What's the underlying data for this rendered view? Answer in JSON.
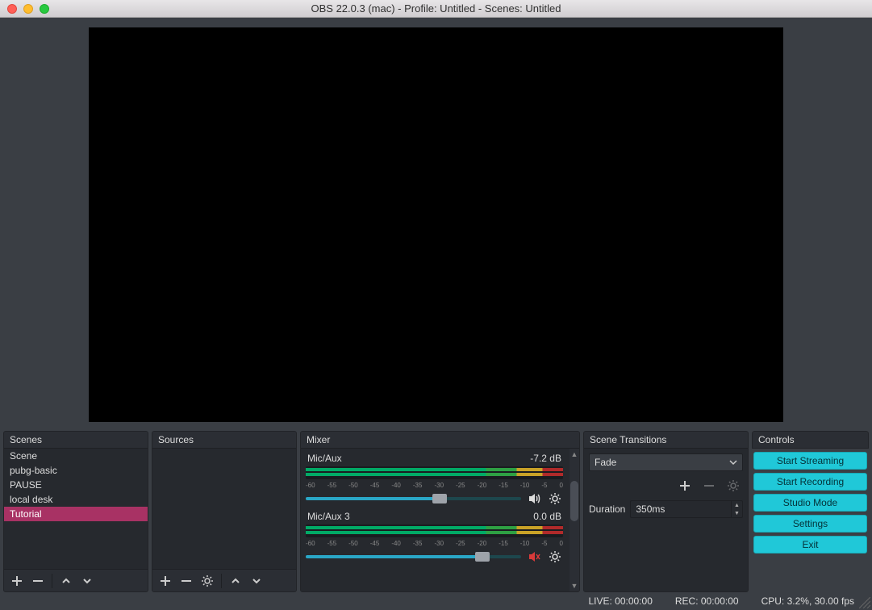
{
  "window": {
    "title": "OBS 22.0.3 (mac) - Profile: Untitled - Scenes: Untitled"
  },
  "panels": {
    "scenes_label": "Scenes",
    "sources_label": "Sources",
    "mixer_label": "Mixer",
    "transitions_label": "Scene Transitions",
    "controls_label": "Controls"
  },
  "scenes": {
    "items": [
      "Scene",
      "pubg-basic",
      "PAUSE",
      "local desk",
      "Tutorial"
    ],
    "selected_index": 4
  },
  "sources": {
    "items": []
  },
  "mixer": {
    "channels": [
      {
        "name": "Mic/Aux",
        "level": "-7.2 dB",
        "muted": false,
        "slider_pct": 62
      },
      {
        "name": "Mic/Aux 3",
        "level": "0.0 dB",
        "muted": true,
        "slider_pct": 82
      }
    ],
    "ticks": [
      "-60",
      "-55",
      "-50",
      "-45",
      "-40",
      "-35",
      "-30",
      "-25",
      "-20",
      "-15",
      "-10",
      "-5",
      "0"
    ]
  },
  "transitions": {
    "current": "Fade",
    "duration_label": "Duration",
    "duration_value": "350ms"
  },
  "controls": {
    "buttons": [
      "Start Streaming",
      "Start Recording",
      "Studio Mode",
      "Settings",
      "Exit"
    ]
  },
  "statusbar": {
    "live": "LIVE: 00:00:00",
    "rec": "REC: 00:00:00",
    "cpu": "CPU: 3.2%, 30.00 fps"
  }
}
